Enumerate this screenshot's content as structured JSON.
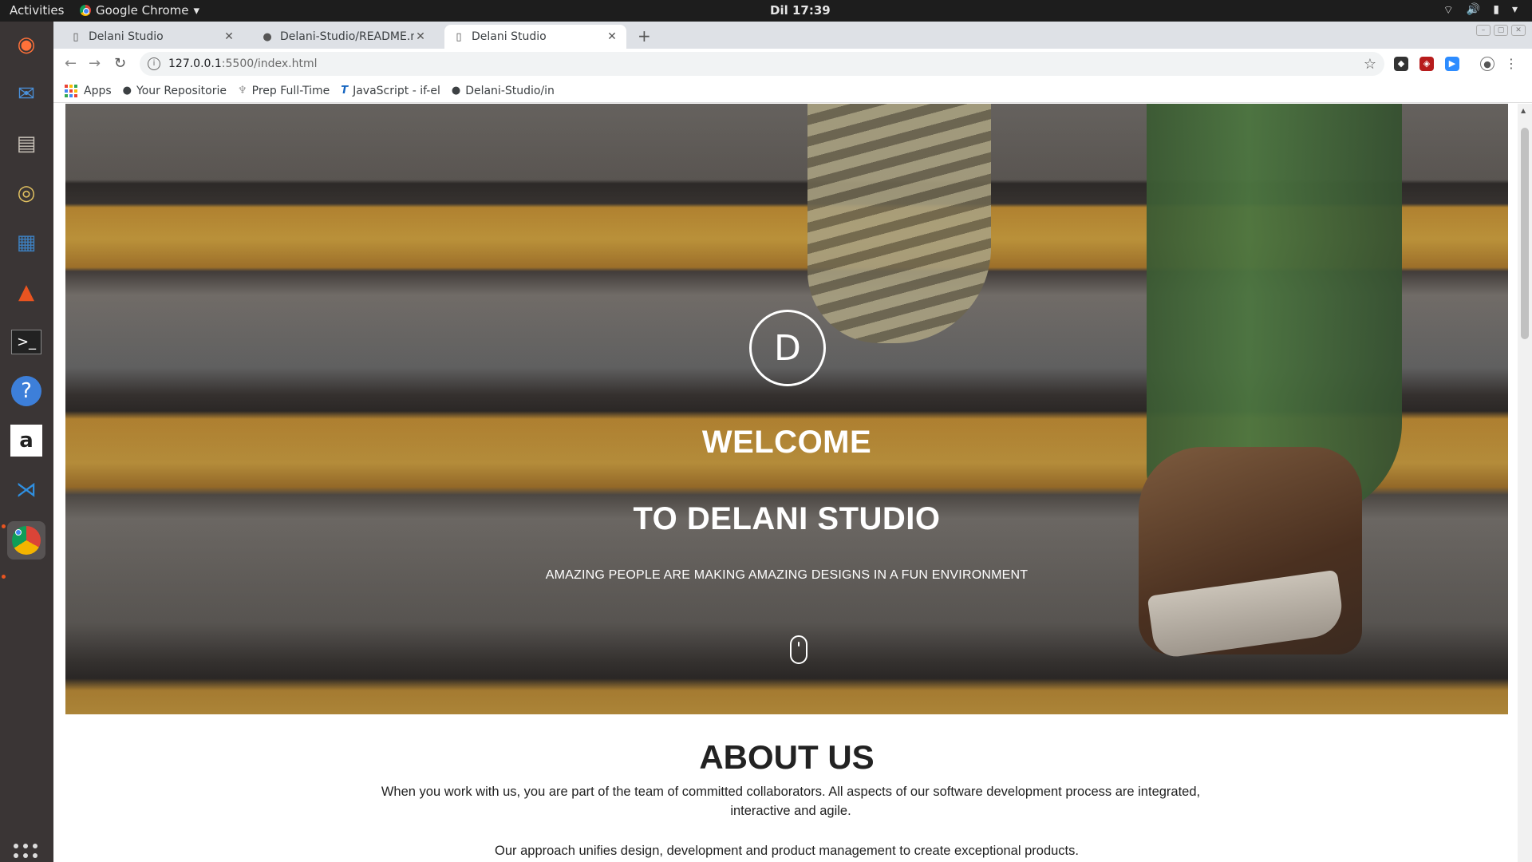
{
  "topbar": {
    "activities": "Activities",
    "app_name": "Google Chrome",
    "clock": "Dil 17:39"
  },
  "tabs": [
    {
      "title": "Delani Studio",
      "active": false
    },
    {
      "title": "Delani-Studio/README.m",
      "active": false
    },
    {
      "title": "Delani Studio",
      "active": true
    }
  ],
  "omnibox": {
    "host": "127.0.0.1",
    "path": ":5500/index.html"
  },
  "bookmarks": [
    {
      "label": "Apps",
      "icon": "apps-grid-icon"
    },
    {
      "label": "Your Repositorie",
      "icon": "github-icon"
    },
    {
      "label": "Prep Full-Time",
      "icon": "prep-icon"
    },
    {
      "label": "JavaScript - if-el",
      "icon": "js-icon"
    },
    {
      "label": "Delani-Studio/in",
      "icon": "github-icon"
    }
  ],
  "hero": {
    "logo_letter": "D",
    "title_line1": "WELCOME",
    "title_line2": "TO DELANI STUDIO",
    "subtitle": "AMAZING PEOPLE ARE MAKING AMAZING DESIGNS IN A FUN ENVIRONMENT"
  },
  "about": {
    "title": "ABOUT US",
    "paragraph1": "When you work with us, you are part of the team of committed collaborators. All aspects of our software development process are integrated, interactive and agile.",
    "paragraph2": "Our approach unifies design, development and product management to create exceptional products."
  },
  "colors": {
    "stair_yellow": "#f0b840",
    "dock_bg": "#3a3535",
    "ubuntu_orange": "#e95420"
  }
}
